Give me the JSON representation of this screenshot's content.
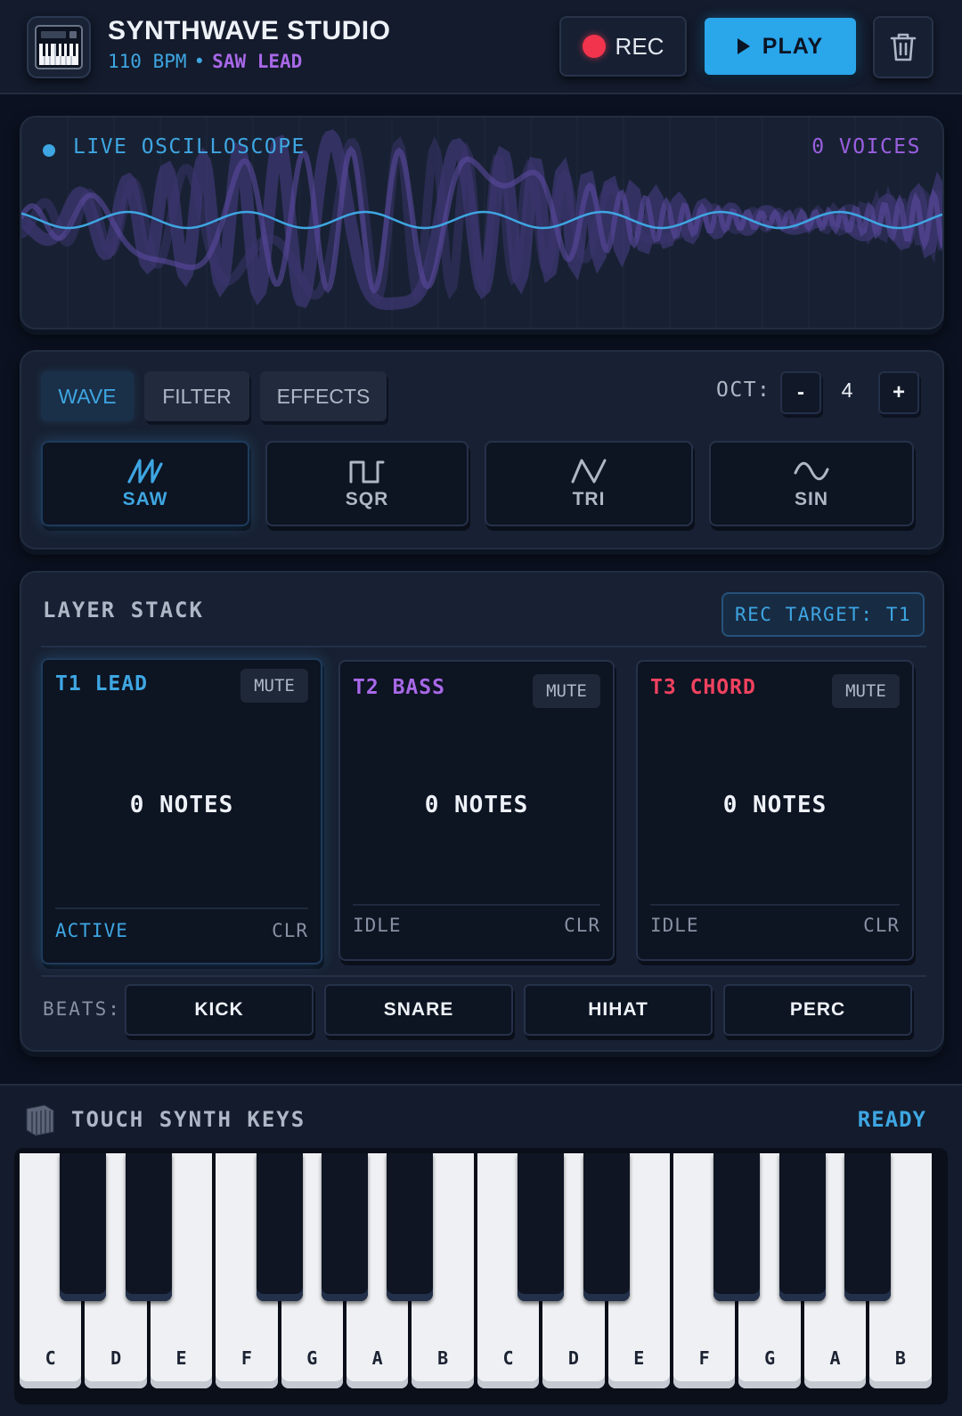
{
  "header": {
    "title": "SYNTHWAVE STUDIO",
    "bpm": "110 BPM",
    "separator": "•",
    "patch": "SAW LEAD",
    "rec_label": "REC",
    "play_label": "PLAY"
  },
  "scope": {
    "label": "LIVE OSCILLOSCOPE",
    "voices": "0 VOICES"
  },
  "controls": {
    "tabs": [
      {
        "label": "WAVE",
        "active": true
      },
      {
        "label": "FILTER",
        "active": false
      },
      {
        "label": "EFFECTS",
        "active": false
      }
    ],
    "octave_label": "OCT:",
    "octave_minus": "-",
    "octave_value": "4",
    "octave_plus": "+",
    "waveforms": [
      {
        "label": "SAW",
        "icon": "saw-wave-icon",
        "active": true
      },
      {
        "label": "SQR",
        "icon": "square-wave-icon",
        "active": false
      },
      {
        "label": "TRI",
        "icon": "triangle-wave-icon",
        "active": false
      },
      {
        "label": "SIN",
        "icon": "sine-wave-icon",
        "active": false
      }
    ]
  },
  "layers": {
    "title": "LAYER STACK",
    "rec_target": "REC TARGET: T1",
    "tracks": [
      {
        "id": "T1",
        "name": "LEAD",
        "color": "#3ea6e2",
        "mute": "MUTE",
        "notes": "0 NOTES",
        "state": "ACTIVE",
        "clear": "CLR"
      },
      {
        "id": "T2",
        "name": "BASS",
        "color": "#a868e8",
        "mute": "MUTE",
        "notes": "0 NOTES",
        "state": "IDLE",
        "clear": "CLR"
      },
      {
        "id": "T3",
        "name": "CHORD",
        "color": "#f0425f",
        "mute": "MUTE",
        "notes": "0 NOTES",
        "state": "IDLE",
        "clear": "CLR"
      }
    ],
    "beats_label": "BEATS:",
    "beats": [
      "KICK",
      "SNARE",
      "HIHAT",
      "PERC"
    ]
  },
  "keyboard": {
    "title": "TOUCH SYNTH KEYS",
    "status": "READY",
    "white_keys": [
      "C",
      "D",
      "E",
      "F",
      "G",
      "A",
      "B",
      "C",
      "D",
      "E",
      "F",
      "G",
      "A",
      "B"
    ]
  },
  "colors": {
    "accent": "#3ea6e2",
    "purple": "#a868e8",
    "red": "#f0425f",
    "background": "#0b1120"
  }
}
